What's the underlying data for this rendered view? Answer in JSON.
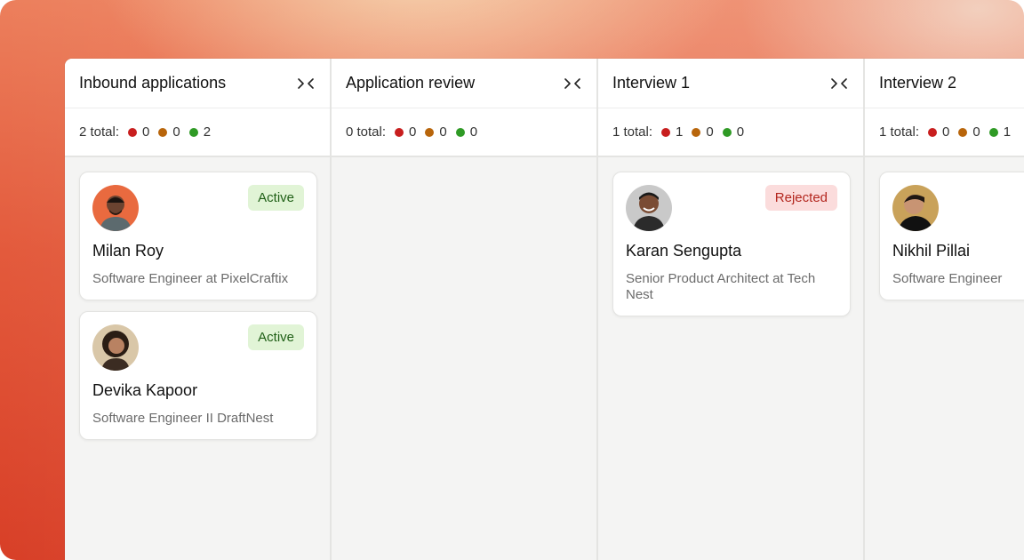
{
  "legend_colors": {
    "red": "#c81e1e",
    "amber": "#b8650b",
    "green": "#2f9a25"
  },
  "columns": [
    {
      "title": "Inbound applications",
      "collapse_icon": "collapse-icon",
      "total_label": "2 total:",
      "counts": {
        "red": "0",
        "amber": "0",
        "green": "2"
      },
      "cards": [
        {
          "name": "Milan Roy",
          "role": "Software Engineer at PixelCraftix",
          "status": "Active",
          "avatar_icon": "avatar-milan"
        },
        {
          "name": "Devika Kapoor",
          "role": "Software Engineer II DraftNest",
          "status": "Active",
          "avatar_icon": "avatar-devika"
        }
      ]
    },
    {
      "title": "Application review",
      "collapse_icon": "collapse-icon",
      "total_label": "0 total:",
      "counts": {
        "red": "0",
        "amber": "0",
        "green": "0"
      },
      "cards": []
    },
    {
      "title": "Interview 1",
      "collapse_icon": "collapse-icon",
      "total_label": "1 total:",
      "counts": {
        "red": "1",
        "amber": "0",
        "green": "0"
      },
      "cards": [
        {
          "name": "Karan Sengupta",
          "role": "Senior Product Architect at Tech Nest",
          "status": "Rejected",
          "avatar_icon": "avatar-karan"
        }
      ]
    },
    {
      "title": "Interview 2",
      "collapse_icon": "collapse-icon",
      "total_label": "1 total:",
      "counts": {
        "red": "0",
        "amber": "0",
        "green": "1"
      },
      "cards": [
        {
          "name": "Nikhil Pillai",
          "role": "Software Engineer",
          "status": "",
          "avatar_icon": "avatar-nikhil"
        }
      ]
    }
  ]
}
